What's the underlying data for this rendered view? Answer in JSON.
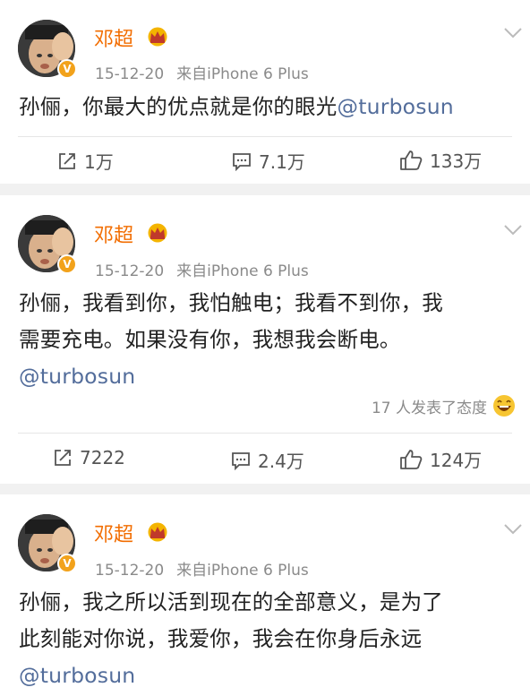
{
  "posts": [
    {
      "author": "邓超",
      "date": "15-12-20",
      "source": "来自iPhone 6 Plus",
      "text": "孙俪，你最大的优点就是你的眼光",
      "mention": "@turbosun",
      "reposts": "1万",
      "comments": "7.1万",
      "likes": "133万"
    },
    {
      "author": "邓超",
      "date": "15-12-20",
      "source": "来自iPhone 6 Plus",
      "text_lines": [
        "孙俪，我看到你，我怕触电；我看不到你，我",
        "需要充电。如果没有你，我想我会断电。"
      ],
      "mention": "@turbosun",
      "reactions": "17 人发表了态度",
      "reposts": "7222",
      "comments": "2.4万",
      "likes": "124万"
    },
    {
      "author": "邓超",
      "date": "15-12-20",
      "source": "来自iPhone 6 Plus",
      "text_lines": [
        "孙俪，我之所以活到现在的全部意义，是为了",
        "此刻能对你说，我爱你，我会在你身后永远"
      ],
      "mention": "@turbosun"
    }
  ],
  "colors": {
    "username": "#f26d00",
    "mention": "#536d9b",
    "meta": "#8a8a8a",
    "separator": "#f1f1f1",
    "badge": "#f2a21b"
  },
  "icons": [
    "verified-badge-icon",
    "crown-icon",
    "chevron-down-icon",
    "repost-icon",
    "comment-icon",
    "like-icon",
    "laugh-emoji-icon"
  ]
}
